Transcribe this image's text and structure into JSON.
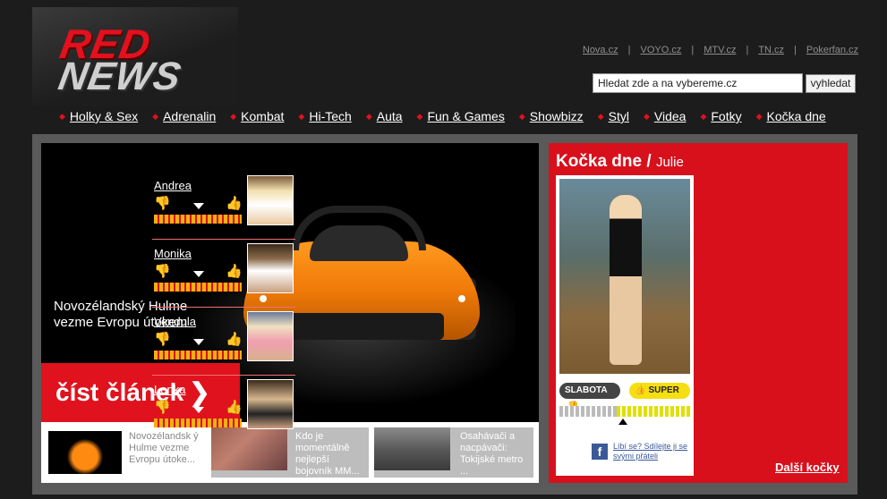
{
  "header": {
    "logo_top": "RED",
    "logo_bottom": "NEWS",
    "links": [
      "Nova.cz",
      "VOYO.cz",
      "MTV.cz",
      "TN.cz",
      "Pokerfan.cz"
    ],
    "link_separator": "|",
    "search": {
      "value": "Hledat zde a na vybereme.cz",
      "button_label": "vyhledat"
    }
  },
  "nav": {
    "items": [
      "Holky & Sex",
      "Adrenalin",
      "Kombat",
      "Hi-Tech",
      "Auta",
      "Fun & Games",
      "Showbizz",
      "Styl",
      "Videa",
      "Fotky",
      "Kočka dne"
    ],
    "bullet_color": "#e3101e"
  },
  "feature": {
    "caption": "Novozélandský Hulme vezme Evropu útokem",
    "read_label": "číst článek",
    "read_arrow": "❯"
  },
  "thumbs": [
    {
      "text": "Novozélandsk ý Hulme vezme Evropu útoke..."
    },
    {
      "text": "Kdo je momentálně nejlepší bojovník MM..."
    },
    {
      "text": "Osahávači a nacpávači: Tokijské metro ..."
    }
  ],
  "sidebar": {
    "title": "Kočka dne",
    "separator": "/",
    "current_name": "Julie",
    "rating": {
      "low_label": "SLABOTA",
      "high_label": "SUPER",
      "level": 0.56
    },
    "facebook": {
      "icon": "f",
      "text": "Líbí se? Sdílejte ji se svými přáteli"
    },
    "girls": [
      {
        "name": "Andrea"
      },
      {
        "name": "Monika"
      },
      {
        "name": "Vendula"
      },
      {
        "name": "Lenka"
      }
    ],
    "more_label": "Další kočky",
    "accent": "#d8101c"
  }
}
